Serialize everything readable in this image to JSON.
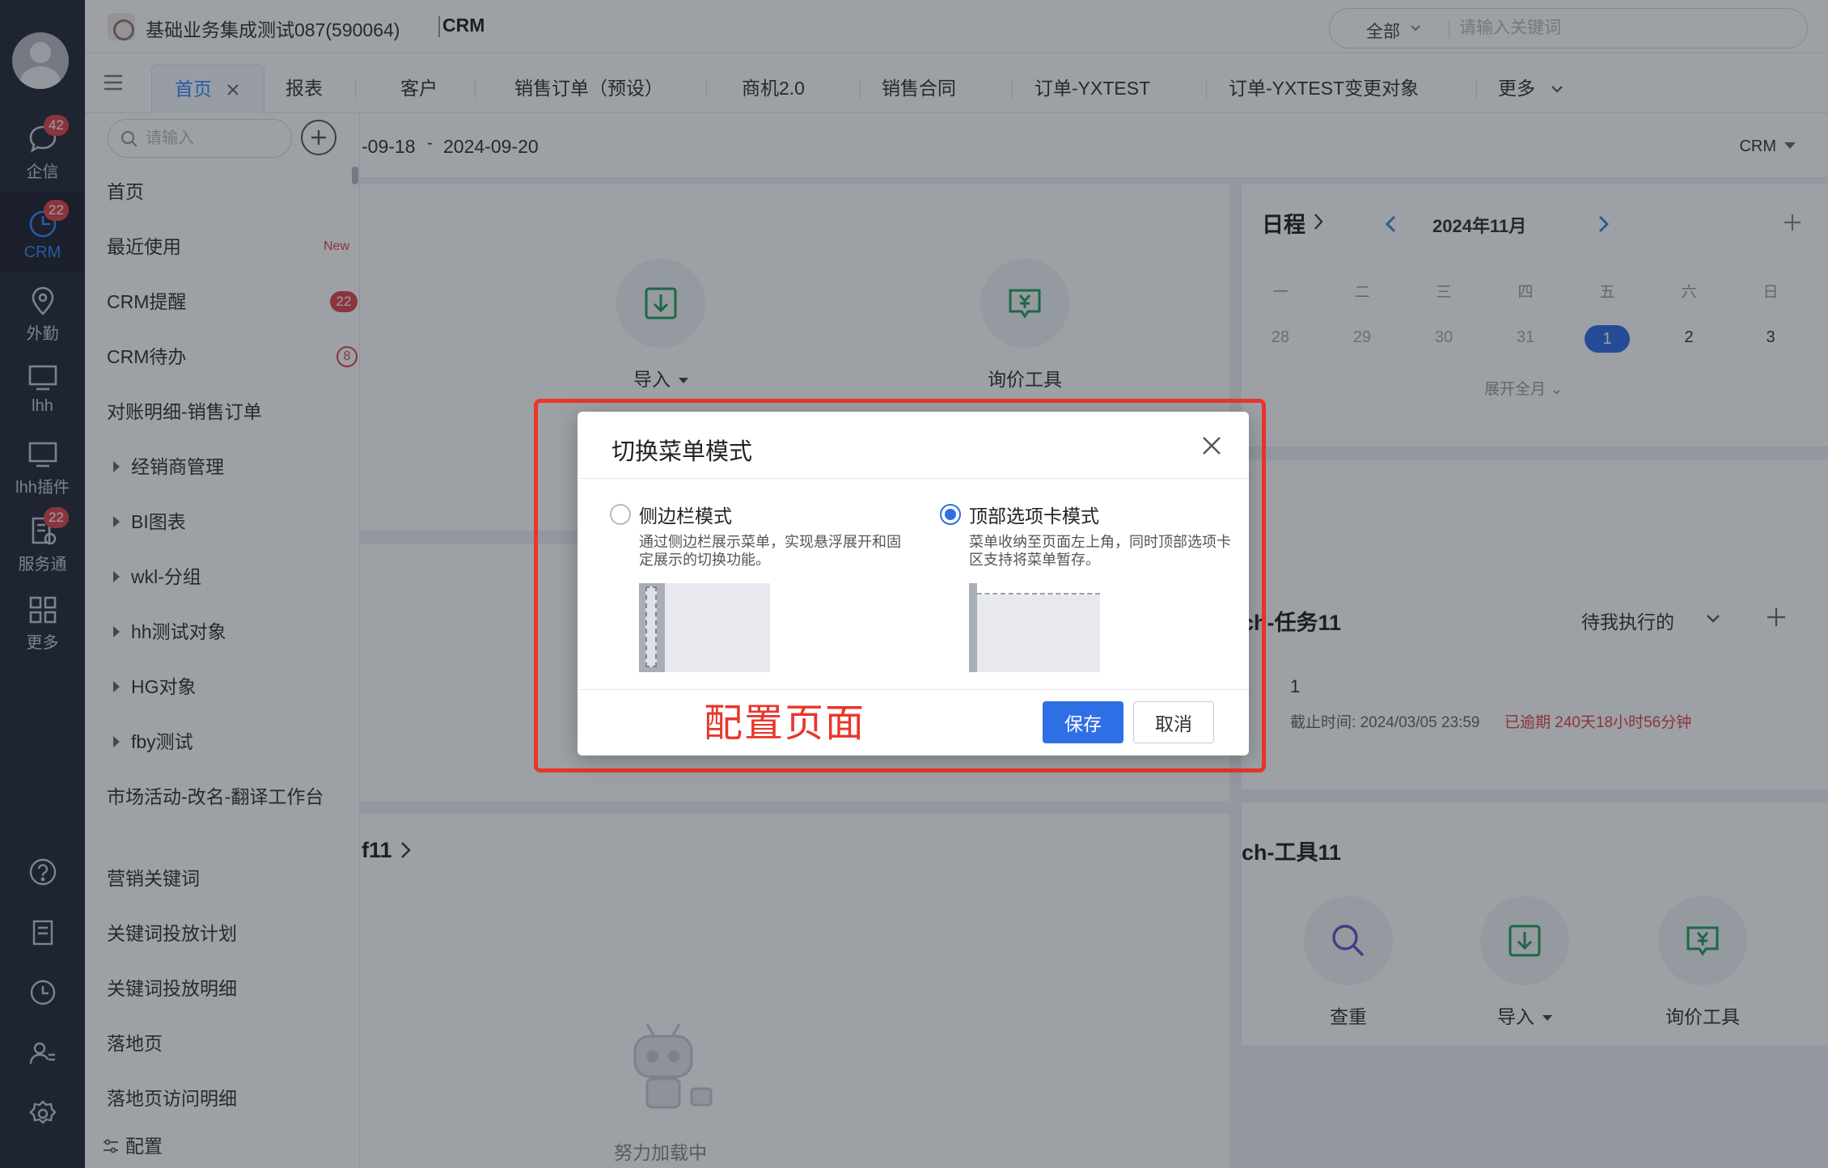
{
  "header": {
    "company": "基础业务集成测试087(590064)",
    "app_name": "CRM",
    "search_scope": "全部",
    "search_placeholder": "请输入关键词"
  },
  "rail": {
    "items": [
      {
        "label": "企信",
        "icon": "chat-icon",
        "badge": "42"
      },
      {
        "label": "CRM",
        "icon": "crm-clock-icon",
        "badge": "22",
        "active": true
      },
      {
        "label": "外勤",
        "icon": "location-pin-icon"
      },
      {
        "label": "lhh",
        "icon": "monitor-icon"
      },
      {
        "label": "lhh插件",
        "icon": "monitor-icon"
      },
      {
        "label": "服务通",
        "icon": "service-icon",
        "badge": "22"
      },
      {
        "label": "更多",
        "icon": "grid-icon"
      }
    ],
    "bottom_icons": [
      "help-icon",
      "notebook-icon",
      "history-icon",
      "contacts-icon",
      "settings-icon"
    ]
  },
  "tabs": {
    "items": [
      "首页",
      "报表",
      "客户",
      "销售订单（预设）",
      "商机2.0",
      "销售合同",
      "订单-YXTEST",
      "订单-YXTEST变更对象"
    ],
    "more": "更多"
  },
  "menu": {
    "search_placeholder": "请输入",
    "items": [
      {
        "label": "首页"
      },
      {
        "label": "最近使用",
        "tag": "New"
      },
      {
        "label": "CRM提醒",
        "count": "22"
      },
      {
        "label": "CRM待办",
        "count": "8"
      },
      {
        "label": "对账明细-销售订单"
      },
      {
        "label": "经销商管理",
        "folder": true
      },
      {
        "label": "BI图表",
        "folder": true
      },
      {
        "label": "wkl-分组",
        "folder": true
      },
      {
        "label": "hh测试对象",
        "folder": true
      },
      {
        "label": "HG对象",
        "folder": true
      },
      {
        "label": "fby测试",
        "folder": true
      },
      {
        "label": "市场活动-改名-翻译工作台"
      },
      {
        "label": "营销关键词"
      },
      {
        "label": "关键词投放计划"
      },
      {
        "label": "关键词投放明细"
      },
      {
        "label": "落地页"
      },
      {
        "label": "落地页访问明细"
      }
    ],
    "config": "配置"
  },
  "main": {
    "date_start": "-09-18",
    "date_dash": "-",
    "date_end": "2024-09-20",
    "scope": "CRM",
    "tool_import": "导入",
    "tool_quote": "询价工具",
    "section_title_partial": "f11",
    "loading": "努力加载中"
  },
  "calendar": {
    "title": "日程",
    "month": "2024年11月",
    "weekdays": [
      "一",
      "二",
      "三",
      "四",
      "五",
      "六",
      "日"
    ],
    "days": [
      "28",
      "29",
      "30",
      "31",
      "1",
      "2",
      "3"
    ],
    "today": "1",
    "expand": "展开全月"
  },
  "tasks": {
    "title": "ch-任务11",
    "filter": "待我执行的",
    "item_name": "1",
    "deadline": "截止时间: 2024/03/05 23:59",
    "overdue": "已逾期 240天18小时56分钟"
  },
  "tools_card": {
    "title": "ch-工具11",
    "items": [
      "查重",
      "导入",
      "询价工具"
    ]
  },
  "modal": {
    "title": "切换菜单模式",
    "option_sidebar_title": "侧边栏模式",
    "option_sidebar_desc": "通过侧边栏展示菜单，实现悬浮展开和固定展示的切换功能。",
    "option_top_title": "顶部选项卡模式",
    "option_top_desc": "菜单收纳至页面左上角，同时顶部选项卡区支持将菜单暂存。",
    "selected": "top",
    "save": "保存",
    "cancel": "取消"
  },
  "annotation": "配置页面",
  "colors": {
    "accent": "#2f6fe6",
    "highlight": "#e8362c",
    "rail": "#252b37",
    "badge": "#e0464c"
  }
}
